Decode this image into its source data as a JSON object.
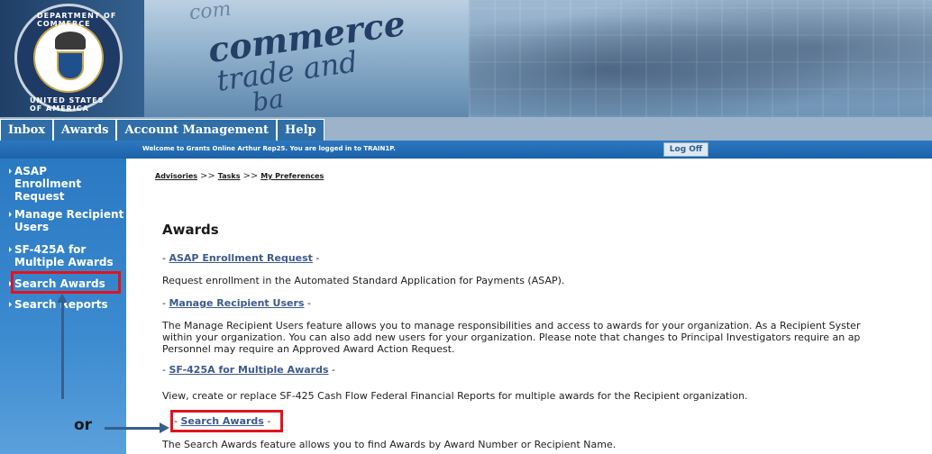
{
  "banner": {
    "seal_text_top": "DEPARTMENT OF COMMERCE",
    "seal_text_bottom": "UNITED STATES OF AMERICA",
    "word_commerce": "commerce",
    "word_trade": "trade and",
    "word_bottom": "ba",
    "word_top": "com"
  },
  "tabs": [
    "Inbox",
    "Awards",
    "Account Management",
    "Help"
  ],
  "welcome": {
    "message": "Welcome to Grants Online Arthur Rep25. You are logged in to TRAIN1P.",
    "logoff_label": "Log Off"
  },
  "sidebar": {
    "items": [
      {
        "label": "ASAP Enrollment Request"
      },
      {
        "label": "Manage Recipient Users"
      },
      {
        "label": "SF-425A for Multiple Awards"
      },
      {
        "label": "Search Awards"
      },
      {
        "label": "Search Reports"
      }
    ]
  },
  "breadcrumb": {
    "items": [
      "Advisories",
      "Tasks",
      "My Preferences"
    ],
    "separator": ">>"
  },
  "main": {
    "title": "Awards",
    "sections": [
      {
        "link": "ASAP Enrollment Request",
        "description": "Request enrollment in the Automated Standard Application for Payments (ASAP)."
      },
      {
        "link": "Manage Recipient Users",
        "description_lines": [
          "The Manage Recipient Users feature allows you to manage responsibilities and access to awards for your organization. As a Recipient Syster",
          "within your organization. You can also add new users for your organization. Please note that changes to Principal Investigators require an ap",
          "Personnel may require an Approved Award Action Request."
        ]
      },
      {
        "link": "SF-425A for Multiple Awards",
        "description": "View, create or replace SF-425 Cash Flow Federal Financial Reports for multiple awards for the Recipient organization."
      },
      {
        "link": "Search Awards",
        "description": "The Search Awards feature allows you to find Awards by Award Number or Recipient Name."
      }
    ],
    "dash": "-"
  },
  "annotation": {
    "or_label": "or",
    "highlight_color": "#e0141e",
    "arrow_color": "#365f8c"
  },
  "colors": {
    "tab_bg": "#2f6ea6",
    "sidebar_bg": "#2a79c2",
    "welcome_bg": "#1c62a8",
    "link": "#3d5a8c"
  }
}
